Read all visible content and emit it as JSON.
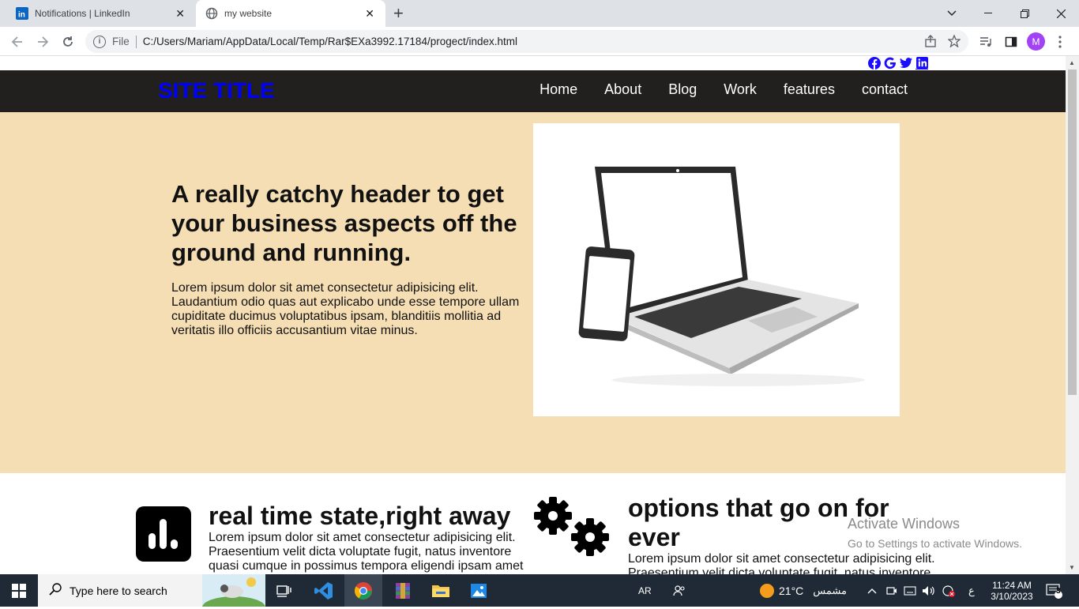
{
  "browser": {
    "tabs": [
      {
        "title": "Notifications | LinkedIn",
        "icon": "linkedin-icon"
      },
      {
        "title": "my website",
        "icon": "globe-icon"
      }
    ],
    "new_tab": "+",
    "address": {
      "file_label": "File",
      "url": "C:/Users/Mariam/AppData/Local/Temp/Rar$EXa3992.17184/progect/index.html"
    },
    "profile_initial": "M"
  },
  "site": {
    "title": "SITE TITLE",
    "nav": [
      "Home",
      "About",
      "Blog",
      "Work",
      "features",
      "contact"
    ],
    "socials": [
      "facebook-icon",
      "google-icon",
      "twitter-icon",
      "linkedin-icon"
    ],
    "hero": {
      "heading": "A really catchy header to get your business aspects off the ground and running.",
      "text": "Lorem ipsum dolor sit amet consectetur adipisicing elit. Laudantium odio quas aut explicabo unde esse tempore ullam cupiditate ducimus voluptatibus ipsam, blanditiis mollitia ad veritatis illo officiis accusantium vitae minus."
    },
    "features": [
      {
        "title": "real time state,right away",
        "text": "Lorem ipsum dolor sit amet consectetur adipisicing elit. Praesentium velit dicta voluptate fugit, natus inventore quasi cumque in possimus tempora eligendi ipsam amet",
        "icon": "bar-chart-icon"
      },
      {
        "title": "options that go on for ever",
        "text": "Lorem ipsum dolor sit amet consectetur adipisicing elit. Praesentium velit dicta voluptate fugit, natus inventore",
        "icon": "gears-icon"
      }
    ],
    "colors": {
      "nav_bg": "#221f1f",
      "hero_bg": "#f5deb3",
      "title": "#0000ff"
    }
  },
  "watermark": {
    "line1": "Activate Windows",
    "line2": "Go to Settings to activate Windows."
  },
  "taskbar": {
    "search_placeholder": "Type here to search",
    "lang": "AR",
    "weather": "21°C",
    "weather_desc": "مشمس",
    "ime": "ع",
    "time": "11:24 AM",
    "date": "3/10/2023",
    "notifications": "3"
  }
}
